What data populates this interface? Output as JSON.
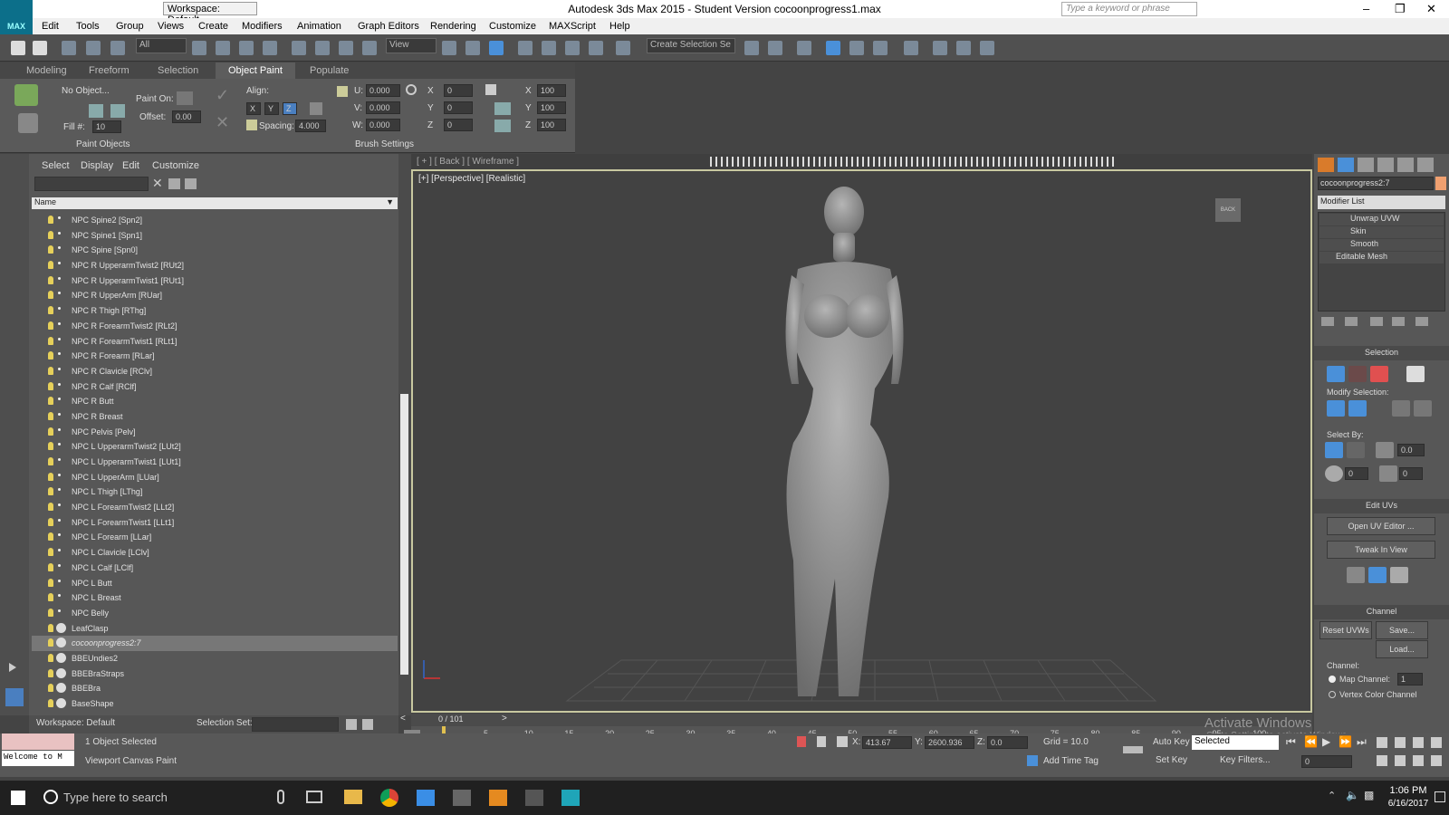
{
  "titlebar": {
    "workspace": "Workspace: Default",
    "title": "Autodesk 3ds Max 2015 - Student Version   cocoonprogress1.max",
    "search_placeholder": "Type a keyword or phrase"
  },
  "menu": [
    "Edit",
    "Tools",
    "Group",
    "Views",
    "Create",
    "Modifiers",
    "Animation",
    "Graph Editors",
    "Rendering",
    "Customize",
    "MAXScript",
    "Help"
  ],
  "toolbar": {
    "filter": "All",
    "refcoord": "View",
    "selection_set": "Create Selection Se"
  },
  "ribbon": {
    "tabs": [
      "Modeling",
      "Freeform",
      "Selection",
      "Object Paint",
      "Populate"
    ],
    "no_object": "No Object...",
    "paint_on": "Paint On:",
    "offset_label": "Offset:",
    "offset": "0.00",
    "fill_label": "Fill #:",
    "fill": "10",
    "align": "Align:",
    "x": "X",
    "y": "Y",
    "z": "Z",
    "u_label": "U:",
    "u": "0.000",
    "v_label": "V:",
    "v": "0.000",
    "w_label": "W:",
    "w": "0.000",
    "spacing_label": "Spacing:",
    "spacing": "4.000",
    "rx": "0",
    "ry": "0",
    "rz": "0",
    "sx": "100",
    "sy": "100",
    "sz": "100",
    "paint_objects": "Paint Objects",
    "brush_settings": "Brush Settings"
  },
  "explorer": {
    "menu": [
      "Select",
      "Display",
      "Edit",
      "Customize"
    ],
    "name_header": "Name",
    "rows": [
      {
        "label": "NPC Spine2 [Spn2]",
        "type": "bone"
      },
      {
        "label": "NPC Spine1 [Spn1]",
        "type": "bone"
      },
      {
        "label": "NPC Spine [Spn0]",
        "type": "bone"
      },
      {
        "label": "NPC R UpperarmTwist2 [RUt2]",
        "type": "bone"
      },
      {
        "label": "NPC R UpperarmTwist1 [RUt1]",
        "type": "bone"
      },
      {
        "label": "NPC R UpperArm [RUar]",
        "type": "bone"
      },
      {
        "label": "NPC R Thigh [RThg]",
        "type": "bone"
      },
      {
        "label": "NPC R ForearmTwist2 [RLt2]",
        "type": "bone"
      },
      {
        "label": "NPC R ForearmTwist1 [RLt1]",
        "type": "bone"
      },
      {
        "label": "NPC R Forearm [RLar]",
        "type": "bone"
      },
      {
        "label": "NPC R Clavicle [RClv]",
        "type": "bone"
      },
      {
        "label": "NPC R Calf [RClf]",
        "type": "bone"
      },
      {
        "label": "NPC R Butt",
        "type": "bone"
      },
      {
        "label": "NPC R Breast",
        "type": "bone"
      },
      {
        "label": "NPC Pelvis [Pelv]",
        "type": "bone"
      },
      {
        "label": "NPC L UpperarmTwist2 [LUt2]",
        "type": "bone"
      },
      {
        "label": "NPC L UpperarmTwist1 [LUt1]",
        "type": "bone"
      },
      {
        "label": "NPC L UpperArm [LUar]",
        "type": "bone"
      },
      {
        "label": "NPC L Thigh [LThg]",
        "type": "bone"
      },
      {
        "label": "NPC L ForearmTwist2 [LLt2]",
        "type": "bone"
      },
      {
        "label": "NPC L ForearmTwist1 [LLt1]",
        "type": "bone"
      },
      {
        "label": "NPC L Forearm [LLar]",
        "type": "bone"
      },
      {
        "label": "NPC L Clavicle [LClv]",
        "type": "bone"
      },
      {
        "label": "NPC L Calf [LClf]",
        "type": "bone"
      },
      {
        "label": "NPC L Butt",
        "type": "bone"
      },
      {
        "label": "NPC L Breast",
        "type": "bone"
      },
      {
        "label": "NPC Belly",
        "type": "bone"
      },
      {
        "label": "LeafClasp",
        "type": "mesh"
      },
      {
        "label": "cocoonprogress2:7",
        "type": "mesh",
        "selected": true
      },
      {
        "label": "BBEUndies2",
        "type": "mesh"
      },
      {
        "label": "BBEBraStraps",
        "type": "mesh"
      },
      {
        "label": "BBEBra",
        "type": "mesh"
      },
      {
        "label": "BaseShape",
        "type": "mesh"
      }
    ],
    "workspace": "Workspace: Default",
    "selection_set_label": "Selection Set:"
  },
  "viewport": {
    "back_label": "[ + ] [ Back ] [ Wireframe ]",
    "label": "[+] [Perspective] [Realistic]",
    "viewcube": "BACK"
  },
  "timeline": {
    "frame": "0 / 101",
    "ticks": [
      "5",
      "10",
      "15",
      "20",
      "25",
      "30",
      "35",
      "40",
      "45",
      "50",
      "55",
      "60",
      "65",
      "70",
      "75",
      "80",
      "85",
      "90",
      "95",
      "100"
    ]
  },
  "command_panel": {
    "object_name": "cocoonprogress2:7",
    "modifier_list": "Modifier List",
    "stack": [
      "Unwrap UVW",
      "Skin",
      "Smooth",
      "Editable Mesh"
    ],
    "selection_title": "Selection",
    "modify_selection": "Modify Selection:",
    "select_by": "Select By:",
    "sel_val1": "0.0",
    "sel_val2": "0",
    "sel_val3": "0",
    "edit_uvs": "Edit UVs",
    "open_uv_editor": "Open UV Editor ...",
    "tweak_in_view": "Tweak In View",
    "channel_title": "Channel",
    "reset_uvws": "Reset UVWs",
    "save": "Save...",
    "load": "Load...",
    "channel_label": "Channel:",
    "map_channel": "Map Channel:",
    "map_channel_value": "1",
    "vertex_color_channel": "Vertex Color Channel"
  },
  "status": {
    "welcome": "Welcome to M",
    "objects_selected": "1 Object Selected",
    "prompt": "Viewport Canvas Paint",
    "x_label": "X:",
    "x": "413.67",
    "y_label": "Y:",
    "y": "2600.936",
    "z_label": "Z:",
    "z": "0.0",
    "grid": "Grid = 10.0",
    "auto_key": "Auto Key",
    "set_key": "Set Key",
    "key_mode": "Selected",
    "key_filters": "Key Filters...",
    "add_time_tag": "Add Time Tag",
    "frame_field": "0"
  },
  "watermark": {
    "line1": "Activate Windows",
    "line2": "Go to Settings to activate Windows."
  },
  "taskbar": {
    "search_placeholder": "Type here to search",
    "time": "1:06 PM",
    "date": "6/16/2017"
  }
}
